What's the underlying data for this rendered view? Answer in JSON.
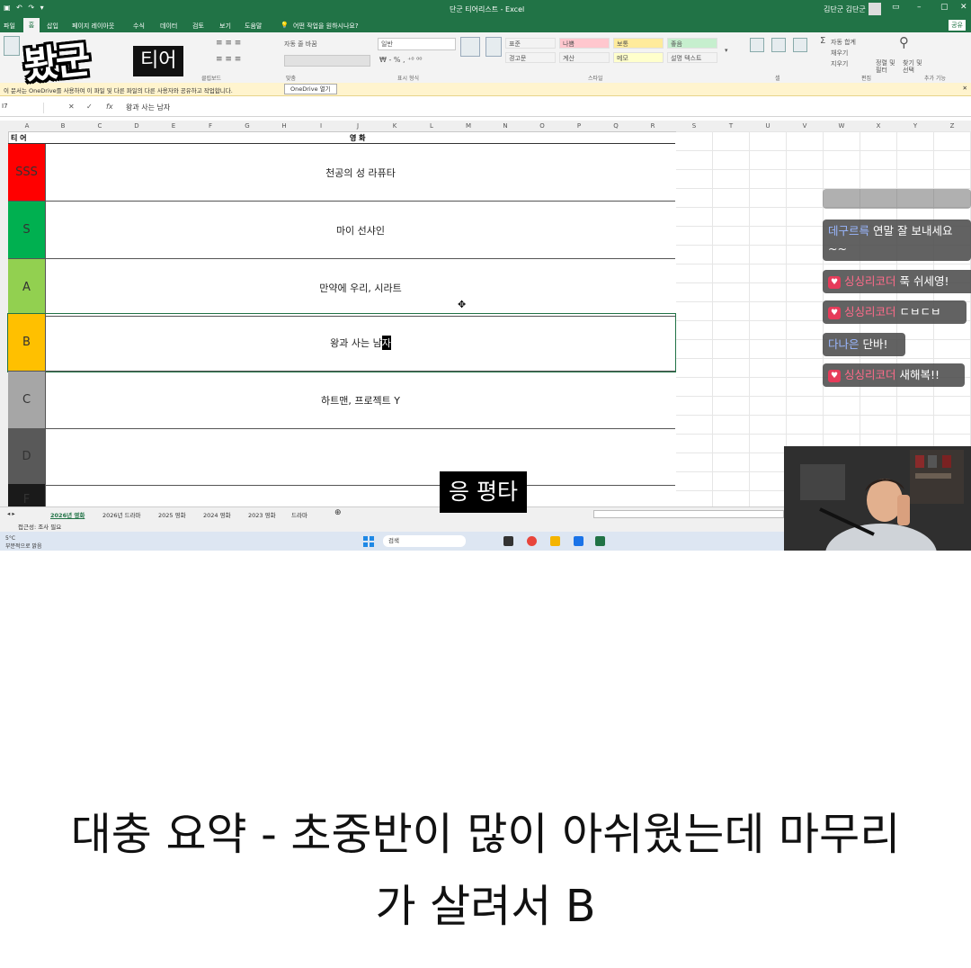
{
  "app": {
    "title": "단군 티어리스트 - Excel",
    "user": "김단군 김단군",
    "share_label": "공유",
    "help_search": "어떤 작업을 원하시나요?"
  },
  "ribbon_tabs": [
    "파일",
    "홈",
    "삽입",
    "페이지 레이아웃",
    "수식",
    "데이터",
    "검토",
    "보기",
    "도움말"
  ],
  "ribbon": {
    "wrap_text": "자동 줄 바꿈",
    "number_format": "일반",
    "styles": [
      {
        "label": "표준",
        "bg": "#ffffff"
      },
      {
        "label": "나쁨",
        "bg": "#ffc7ce"
      },
      {
        "label": "보통",
        "bg": "#ffeb9c"
      },
      {
        "label": "좋음",
        "bg": "#c6efce"
      },
      {
        "label": "경고문",
        "bg": "#ffffff"
      },
      {
        "label": "계산",
        "bg": "#f2f2f2"
      },
      {
        "label": "메모",
        "bg": "#ffffcc"
      },
      {
        "label": "설명 텍스트",
        "bg": "#ffffff"
      }
    ],
    "autosum": "자동 합계",
    "fill": "채우기",
    "clear": "지우기",
    "sort_filter": "정렬 및 필터",
    "find_select": "찾기 및 선택",
    "groups": {
      "clipboard": "클립보드",
      "alignment": "맞춤",
      "number": "표시 형식",
      "styles": "스타일",
      "cells": "셀",
      "editing": "편집",
      "addins": "추가 기능"
    }
  },
  "infobar": {
    "message": "이 문서는 OneDrive를 사용하여 이 파일 및 다른 파일의 다른 사용자와 공유하고 작업합니다.",
    "button": "OneDrive 열기"
  },
  "formula_bar": {
    "name_box": "I7",
    "value": "왕과 사는 남자"
  },
  "columns": [
    "A",
    "B",
    "C",
    "D",
    "E",
    "F",
    "G",
    "H",
    "I",
    "J",
    "K",
    "L",
    "M",
    "N",
    "O",
    "P",
    "Q",
    "R",
    "S",
    "T",
    "U",
    "V",
    "W",
    "X",
    "Y",
    "Z"
  ],
  "table": {
    "tier_header": "티 어",
    "movie_header": "영 화",
    "rows": [
      {
        "tier": "SSS",
        "movies": "천공의 성 라퓨타",
        "color": "#ff0000"
      },
      {
        "tier": "S",
        "movies": "마이 선샤인",
        "color": "#00b050"
      },
      {
        "tier": "A",
        "movies": "만약에 우리, 시라트",
        "color": "#92d050"
      },
      {
        "tier": "B",
        "movies_pre": "왕과 사는 남",
        "movies_hl": "자",
        "color": "#ffc000"
      },
      {
        "tier": "C",
        "movies": "하트맨, 프로젝트 Y",
        "color": "#a6a6a6"
      },
      {
        "tier": "D",
        "movies": "",
        "color": "#595959"
      },
      {
        "tier": "F",
        "movies": "",
        "color": "#1a1a1a"
      }
    ]
  },
  "sheet_tabs": [
    "2026년 영화",
    "2026년 드라마",
    "2025 영화",
    "2024 영화",
    "2023 영화",
    "드라마"
  ],
  "status": {
    "accessibility": "접근성: 조사 필요"
  },
  "taskbar": {
    "temperature": "5°C",
    "weather": "부분적으로 맑음",
    "search_placeholder": "검색"
  },
  "overlay": {
    "logo": "봤군",
    "logo_sub": "티어",
    "caption": "응 평타"
  },
  "chat": [
    {
      "nick": "데구르륵",
      "text": "연말 잘 보내세요~~",
      "heart": false
    },
    {
      "nick": "싱싱리코더",
      "text": "푹 쉬세영!",
      "heart": true
    },
    {
      "nick": "싱싱리코더",
      "text": "ㄷㅂㄷㅂ",
      "heart": true
    },
    {
      "nick": "다나은",
      "text": "단바!",
      "heart": false
    },
    {
      "nick": "싱싱리코더",
      "text": "새해복!!",
      "heart": true
    }
  ],
  "bottom_caption": {
    "line1": "대충 요약 - 초중반이 많이 아쉬웠는데 마무리",
    "line2": "가 살려서 B"
  }
}
